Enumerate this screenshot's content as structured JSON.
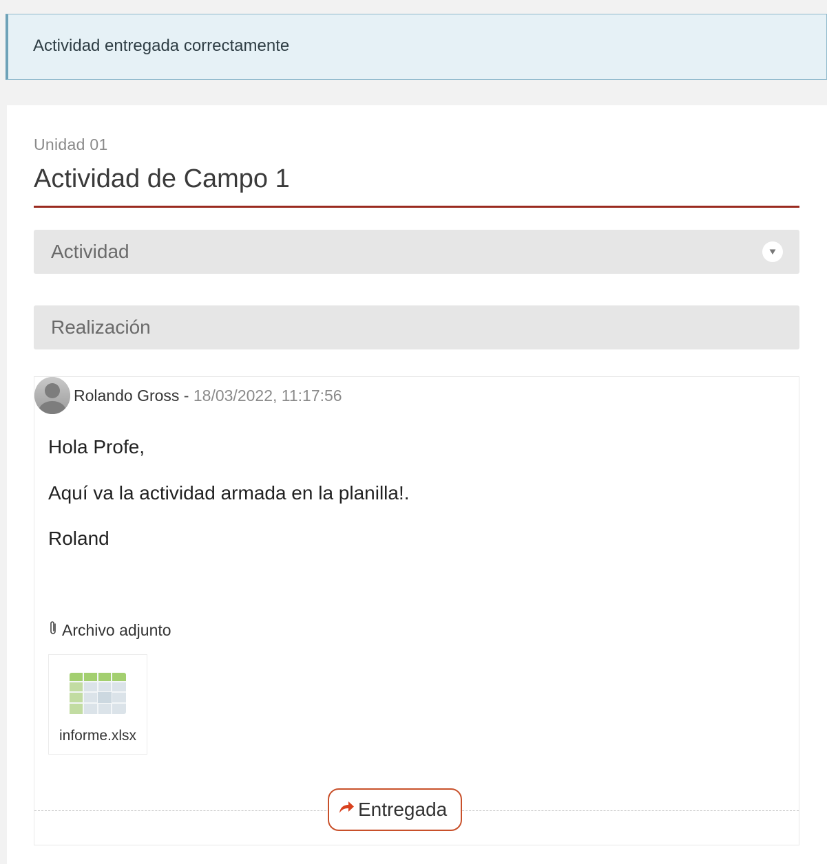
{
  "alert": {
    "message": "Actividad entregada correctamente"
  },
  "header": {
    "unit": "Unidad 01",
    "title": "Actividad de Campo 1"
  },
  "sections": {
    "activity_label": "Actividad",
    "realizacion_label": "Realización"
  },
  "post": {
    "author": "Rolando Gross",
    "separator": " - ",
    "datetime": "18/03/2022, 11:17:56",
    "message_lines": [
      "Hola Profe,",
      "Aquí va la actividad armada en la planilla!.",
      "Roland"
    ],
    "attachments_heading": "Archivo adjunto",
    "attachments": [
      {
        "file_name": "informe.xlsx",
        "icon": "spreadsheet-icon"
      }
    ],
    "status_label": "Entregada",
    "status_icon": "share-arrow-icon"
  },
  "colors": {
    "accent_red": "#9a2a1f",
    "status_orange": "#c8502a",
    "alert_bg": "#e6f1f6",
    "alert_border": "#6ea2b8"
  }
}
